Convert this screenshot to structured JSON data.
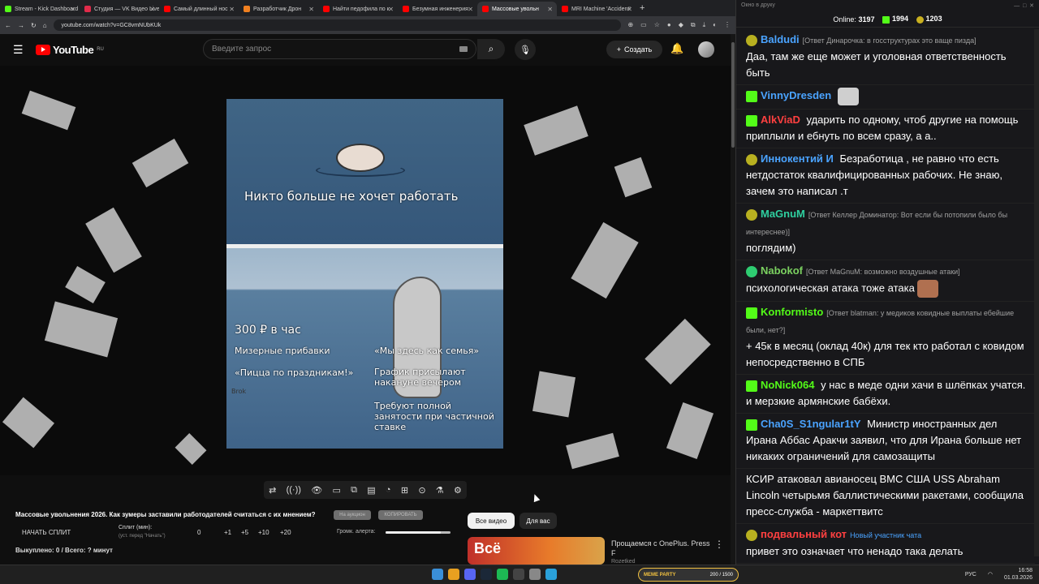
{
  "browser": {
    "tabs": [
      {
        "label": "Stream - Kick Dashboard",
        "color": "#53fc18"
      },
      {
        "label": "Студия — VK Видео Live",
        "color": "#e02b4a"
      },
      {
        "label": "Самый длинный нос",
        "color": "#ff0000"
      },
      {
        "label": "Разработчик Дрон",
        "color": "#f08020"
      },
      {
        "label": "Найти педофила по к",
        "color": "#ff0000"
      },
      {
        "label": "Безумная инженерия",
        "color": "#ff0000"
      },
      {
        "label": "Массовые увольн",
        "color": "#ff0000"
      },
      {
        "label": "MRI Machine 'Accident'",
        "color": "#ff0000"
      }
    ],
    "url": "youtube.com/watch?v=GC8vmNUbKUk",
    "new_tab": "+"
  },
  "youtube": {
    "logo": "YouTube",
    "region": "RU",
    "search_placeholder": "Введите запрос",
    "create_label": "Создать"
  },
  "meme": {
    "top_caption": "Никто больше не хочет работать",
    "left_lines": [
      "300 ₽ в час",
      "Мизерные прибавки",
      "«Пицца по праздникам!»"
    ],
    "right_lines": [
      "«Мы здесь как семья»",
      "График присылают накануне вечером",
      "Требуют полной занятости при частичной ставке"
    ],
    "signature": "Brok"
  },
  "player_controls": [
    "⇄",
    "((·))",
    "👁",
    "▭",
    "⧉",
    "▤",
    "◔",
    "⊞",
    "⊙",
    "⚗",
    "⚙"
  ],
  "splitter": {
    "video_title": "Массовые увольнения 2026. Как зумеры заставили работодателей считаться с их мнением?",
    "chip_auction": "На аукцион",
    "chip_copy": "КОПИРОВАТЬ",
    "start_split": "НАЧАТЬ СПЛИТ",
    "split_min_label": "Сплит (мин):",
    "split_min_hint": "(уст. перед \"Начать\")",
    "split_value": "0",
    "increments": [
      "+1",
      "+5",
      "+10",
      "+20"
    ],
    "alert_volume_label": "Громк. алерта:",
    "alert_volume": 0.85,
    "bought": "Выкуплено: 0 / Всего: ? минут"
  },
  "recommendations": {
    "filters": [
      "Все видео",
      "Для вас"
    ],
    "video_title": "Прощаемся с OnePlus. Press F",
    "channel": "Rozetked",
    "thumb_text": "Всё"
  },
  "chat": {
    "window_title": "Окно в друку",
    "online_label": "Online:",
    "online_count": "3197",
    "kick_count": "1994",
    "vk_count": "1203",
    "messages": [
      {
        "badge": "bp",
        "nick": "Baldudi",
        "color": "#4aa3ff",
        "reply": "[Ответ Динарочка: в госструктурах это ваще пизда]",
        "text": "Даа, там же еще может и уголовная ответственность быть"
      },
      {
        "badge": "bk",
        "nick": "VinnyDresden",
        "color": "#4aa3ff",
        "reply": "",
        "text": ""
      },
      {
        "badge": "bk",
        "nick": "AlkViaD",
        "color": "#ff4040",
        "reply": "",
        "text": "ударить по одному, чтоб другие на помощь приплыли и ебнуть по всем сразу, а а.."
      },
      {
        "badge": "bp",
        "nick": "Иннокентий И",
        "color": "#4aa3ff",
        "reply": "",
        "text": "Безработица , не равно что есть нетдостаток квалифицированных рабочих. Не знаю, зачем это написал .т"
      },
      {
        "badge": "bp",
        "nick": "MaGnuM",
        "color": "#2fd0a0",
        "reply": "[Ответ Келлер Доминатор: Вот если бы потопили было бы интереснее)]",
        "text": "поглядим)"
      },
      {
        "badge": "bv",
        "nick": "Nabokof",
        "color": "#7bd160",
        "reply": "[Ответ MaGnuM: возможно воздушные атаки]",
        "text": "психологическая атака тоже атака"
      },
      {
        "badge": "bk",
        "nick": "Konformisto",
        "color": "#53fc18",
        "reply": "[Ответ blatman: у медиков ковидные выплаты ебейшие были, нет?]",
        "text": "+ 45к в месяц (оклад 40к) для тек кто работал с ковидом непосредственно в СПБ"
      },
      {
        "badge": "bk",
        "nick": "NoNick064",
        "color": "#53fc18",
        "reply": "",
        "text": "у нас в меде одни хачи в шлёпках учатся. и мерзкие армянские бабёхи."
      },
      {
        "badge": "bk",
        "nick": "Cha0S_S1ngular1tY",
        "color": "#4aa3ff",
        "reply": "",
        "text": "Министр иностранных дел Ирана Аббас Аракчи заявил, что для Ирана больше нет никаких ограничений для самозащиты"
      },
      {
        "badge": "",
        "nick": "",
        "color": "#ffffff",
        "reply": "",
        "text": "КСИР атаковал авианосец ВМС США USS Abraham Lincoln четырьмя баллистическими ракетами, сообщила пресс-служба - маркеттвитс"
      },
      {
        "badge": "bp",
        "nick": "подвальный кот",
        "color": "#ff4040",
        "reply": "Новый участник чата",
        "text": "привет это означает что ненадо така делать"
      }
    ]
  },
  "taskbar": {
    "meme_party": "MEME PARTY",
    "meme_party_progress": "200 / 1500",
    "lang": "РУС",
    "time": "16:58",
    "date": "01.03.2026"
  }
}
